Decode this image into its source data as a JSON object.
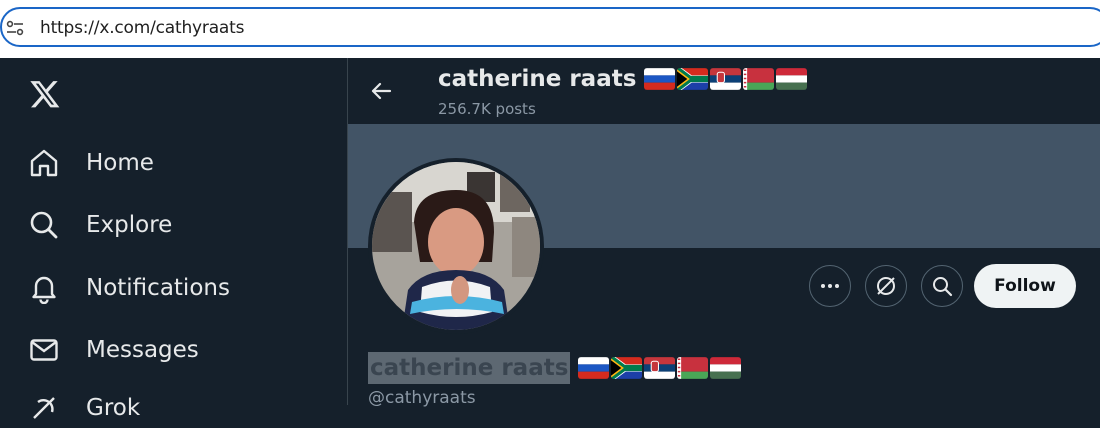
{
  "browser": {
    "url": "https://x.com/cathyraats"
  },
  "sidebar": {
    "items": [
      {
        "label": "Home",
        "icon": "home-icon"
      },
      {
        "label": "Explore",
        "icon": "search-icon"
      },
      {
        "label": "Notifications",
        "icon": "bell-icon"
      },
      {
        "label": "Messages",
        "icon": "envelope-icon"
      },
      {
        "label": "Grok",
        "icon": "grok-icon"
      }
    ]
  },
  "header": {
    "name": "catherine raats",
    "posts": "256.7K posts",
    "flags": [
      "russia-flag",
      "south-africa-flag",
      "serbia-flag",
      "belarus-flag",
      "hungary-flag"
    ]
  },
  "profile": {
    "name": "catherine raats",
    "handle": "@cathyraats",
    "follow_label": "Follow"
  },
  "colors": {
    "background": "#15202b",
    "banner": "#425466",
    "text": "#e7e9ea",
    "muted": "#8b98a5",
    "focus_ring": "#1a66c7"
  }
}
